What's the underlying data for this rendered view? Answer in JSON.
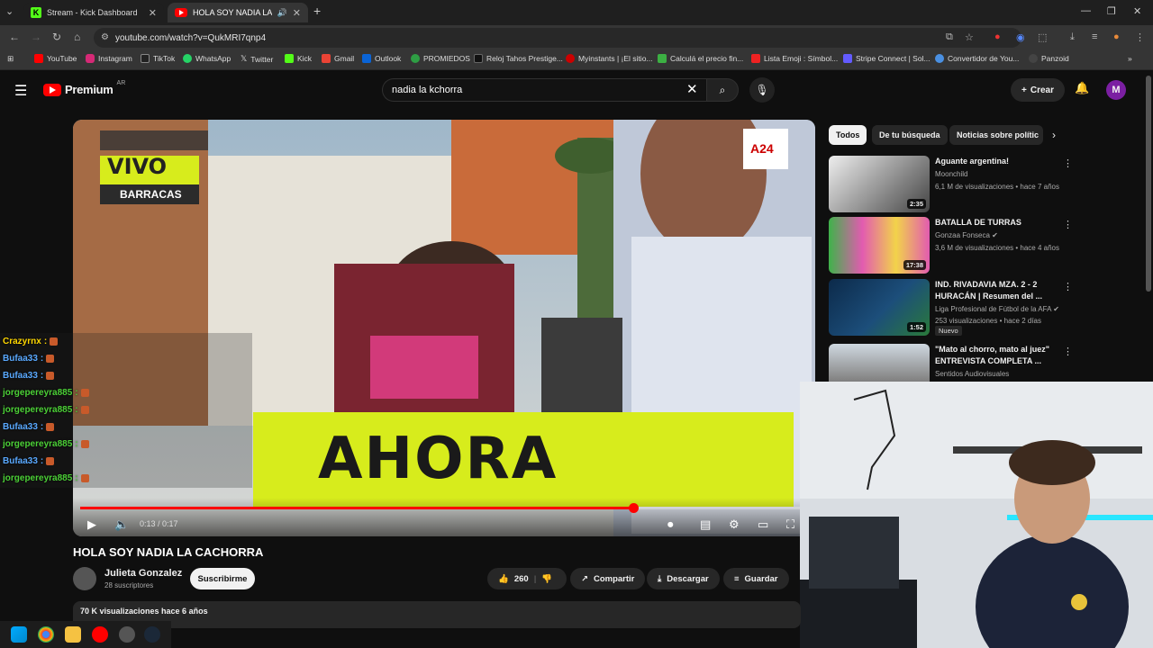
{
  "browser": {
    "tabs": [
      {
        "title": "Stream - Kick Dashboard",
        "active": false
      },
      {
        "title": "HOLA SOY NADIA LA CACHORRA",
        "active": true
      }
    ],
    "url": "youtube.com/watch?v=QukMRI7qnp4",
    "bookmarks": [
      "YouTube",
      "Instagram",
      "TikTok",
      "WhatsApp",
      "Twitter",
      "Kick",
      "Gmail",
      "Outlook",
      "PROMIEDOS",
      "Reloj Tahos Prestige...",
      "Myinstants | ¡El sitio...",
      "Calculá el precio fin...",
      "Lista Emoji : Símbol...",
      "Stripe Connect | Sol...",
      "Convertidor de You...",
      "Panzoid"
    ]
  },
  "header": {
    "logo_text": "Premium",
    "region": "AR",
    "search_value": "nadia la kchorra",
    "create_label": "Crear",
    "avatar_letter": "M"
  },
  "player": {
    "overlay_vivo": "VIVO",
    "overlay_location": "BARRACAS",
    "overlay_main": "AHORA",
    "channel_logo": "A24",
    "time_display": "0:13 / 0:17",
    "progress": 0.76
  },
  "chat": [
    {
      "user": "Crazyrnx",
      "color": "#ffd700"
    },
    {
      "user": "Bufaa33",
      "color": "#5aa9ff"
    },
    {
      "user": "Bufaa33",
      "color": "#5aa9ff"
    },
    {
      "user": "jorgepereyra885",
      "color": "#4cd137"
    },
    {
      "user": "jorgepereyra885",
      "color": "#4cd137"
    },
    {
      "user": "Bufaa33",
      "color": "#5aa9ff"
    },
    {
      "user": "jorgepereyra885",
      "color": "#4cd137"
    },
    {
      "user": "Bufaa33",
      "color": "#5aa9ff"
    },
    {
      "user": "jorgepereyra885",
      "color": "#4cd137"
    }
  ],
  "video": {
    "title": "HOLA SOY NADIA LA CACHORRA",
    "channel": "Julieta Gonzalez",
    "subscribers": "28 suscriptores",
    "subscribe_label": "Suscribirme",
    "likes": "260",
    "share_label": "Compartir",
    "download_label": "Descargar",
    "save_label": "Guardar",
    "views_date": "70 K visualizaciones  hace 6 años"
  },
  "sidebar": {
    "chips": [
      "Todos",
      "De tu búsqueda",
      "Noticias sobre polític"
    ],
    "recommendations": [
      {
        "title": "Aguante argentina!",
        "channel": "Moonchild",
        "meta": "6,1 M de visualizaciones • hace 7 años",
        "duration": "2:35"
      },
      {
        "title": "BATALLA DE TURRAS",
        "channel": "Gonzaa Fonseca",
        "meta": "3,6 M de visualizaciones • hace 4 años",
        "duration": "17:38"
      },
      {
        "title": "IND. RIVADAVIA MZA. 2 - 2 HURACÁN | Resumen del ...",
        "channel": "Liga Profesional de Fútbol de la AFA",
        "meta": "253 visualizaciones • hace 2 días",
        "duration": "1:52",
        "badge": "Nuevo"
      },
      {
        "title": "\"Mato al chorro, mato al juez\" ENTREVISTA COMPLETA ...",
        "channel": "Sentidos Audiovisuales",
        "meta": ""
      }
    ]
  },
  "colors": {
    "accent": "#ff0000",
    "overlay_yellow": "#d7ec1c"
  }
}
